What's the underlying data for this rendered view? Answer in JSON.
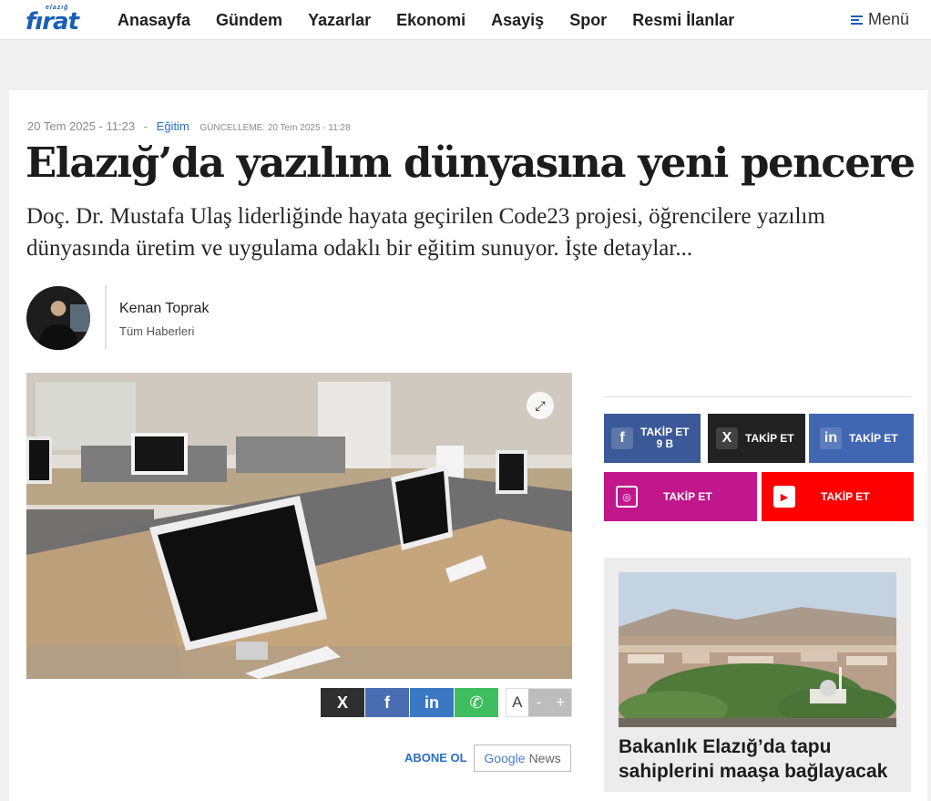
{
  "site": {
    "logo_small": "elazığ",
    "logo_big": "fırat"
  },
  "nav": {
    "items": [
      "Anasayfa",
      "Gündem",
      "Yazarlar",
      "Ekonomi",
      "Asayiş",
      "Spor",
      "Resmi İlanlar"
    ],
    "menu_label": "Menü"
  },
  "article": {
    "date": "20 Tem 2025 - 11:23",
    "separator": "-",
    "category": "Eğitim",
    "updated": "GÜNCELLEME: 20 Tem 2025 - 11:28",
    "title": "Elazığ’da yazılım dünyasına yeni pencere",
    "summary": "Doç. Dr. Mustafa Ulaş liderliğinde hayata geçirilen Code23 projesi, öğrencilere yazılım dünyasında üretim ve uygulama odaklı bir eğitim sunuyor. İşte detaylar...",
    "author_name": "Kenan Toprak",
    "author_link": "Tüm Haberleri"
  },
  "share": {
    "x": "X",
    "facebook": "f",
    "linkedin": "in",
    "whatsapp": "✆"
  },
  "font_control": {
    "a": "A",
    "minus": "-",
    "plus": "+"
  },
  "subscribe": {
    "label": "ABONE OL",
    "google": "Google",
    "news": "News"
  },
  "social": {
    "facebook": {
      "label": "TAKİP ET",
      "count": "9 B",
      "color": "#3b5998"
    },
    "x": {
      "label": "TAKİP ET",
      "color": "#222222"
    },
    "linkedin": {
      "label": "TAKİP ET",
      "color": "#4267b2"
    },
    "instagram": {
      "label": "TAKİP ET",
      "color": "#c1168c"
    },
    "youtube": {
      "label": "TAKİP ET",
      "color": "#ff0000"
    }
  },
  "sidebar_news": {
    "title": "Bakanlık Elazığ’da tapu sahiplerini maaşa bağlayacak"
  },
  "colors": {
    "accent": "#2a6ec6",
    "logo": "#1a5fb4"
  }
}
